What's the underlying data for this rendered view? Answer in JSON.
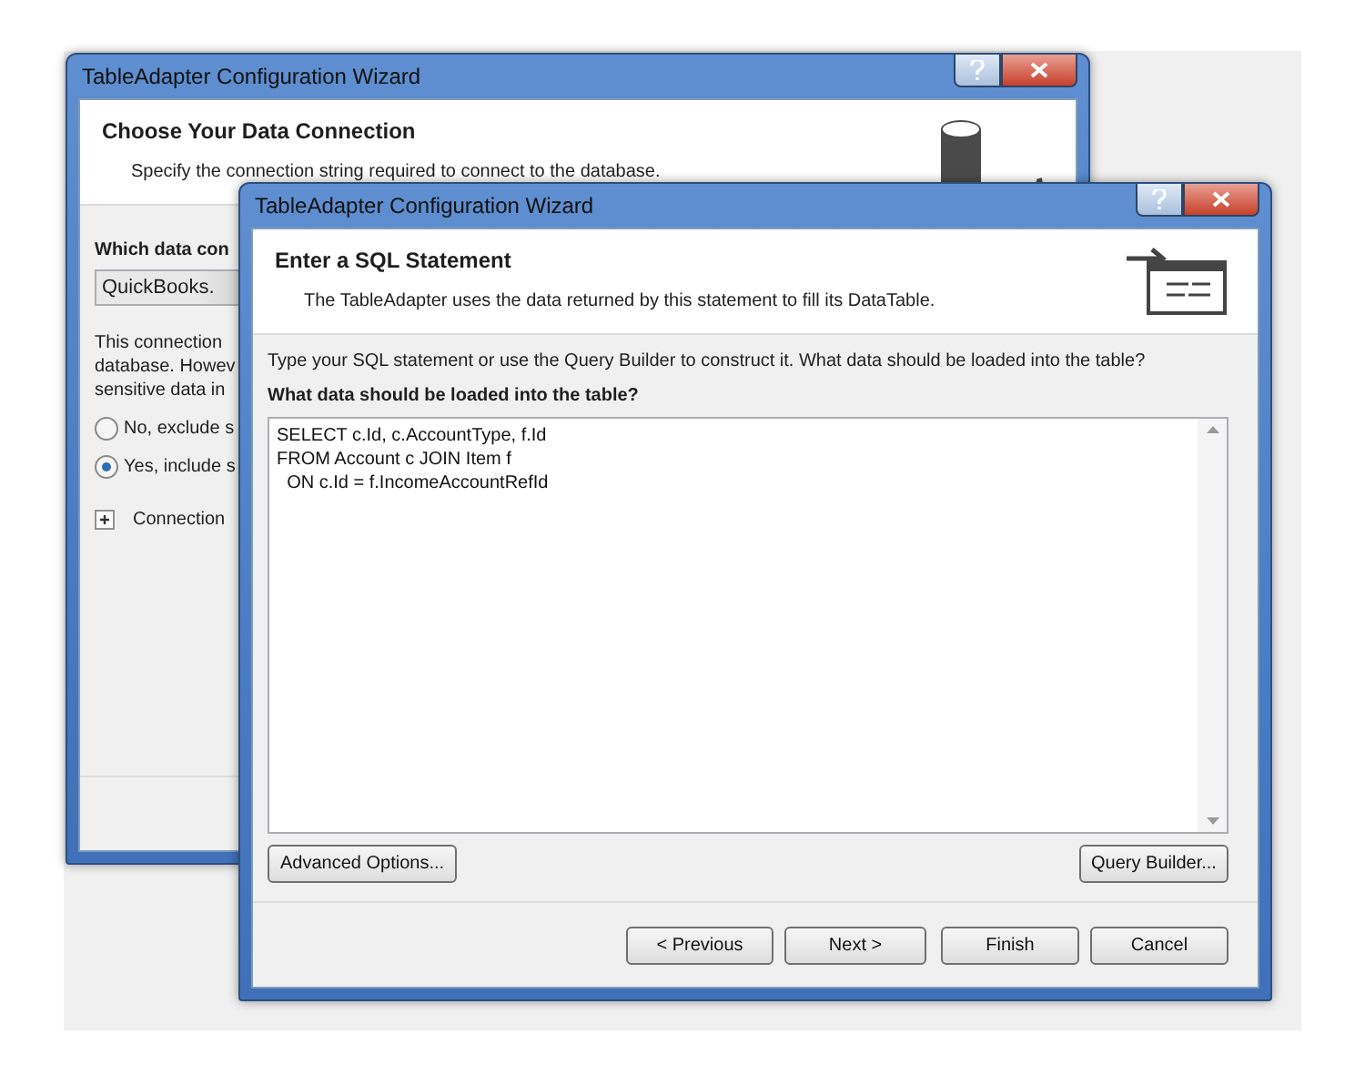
{
  "background_window": {
    "title": "TableAdapter Configuration Wizard",
    "heading": "Choose Your Data Connection",
    "subtitle": "Specify the connection string required to connect to the database.",
    "question": "Which data con",
    "connection_value": "QuickBooks.",
    "note_lines": [
      "This connection",
      "database. Howev",
      "sensitive data in"
    ],
    "radios": [
      {
        "label": "No, exclude s",
        "selected": false
      },
      {
        "label": "Yes, include s",
        "selected": true
      }
    ],
    "expander": {
      "label": "Connection",
      "expanded": false
    }
  },
  "dialog": {
    "title": "TableAdapter Configuration Wizard",
    "heading": "Enter a SQL Statement",
    "subtitle": "The TableAdapter uses the data returned by this statement to fill its DataTable.",
    "instructions": "Type your SQL statement or use the Query Builder to construct it. What data should be loaded into the table?",
    "sql_label": "What data should be loaded into the table?",
    "sql": "SELECT c.Id, c.AccountType, f.Id\nFROM Account c JOIN Item f\n  ON c.Id = f.IncomeAccountRefId",
    "tool_buttons": [
      "Advanced Options...",
      "Query Builder..."
    ],
    "nav_buttons": [
      "< Previous",
      "Next >",
      "Finish",
      "Cancel"
    ]
  }
}
